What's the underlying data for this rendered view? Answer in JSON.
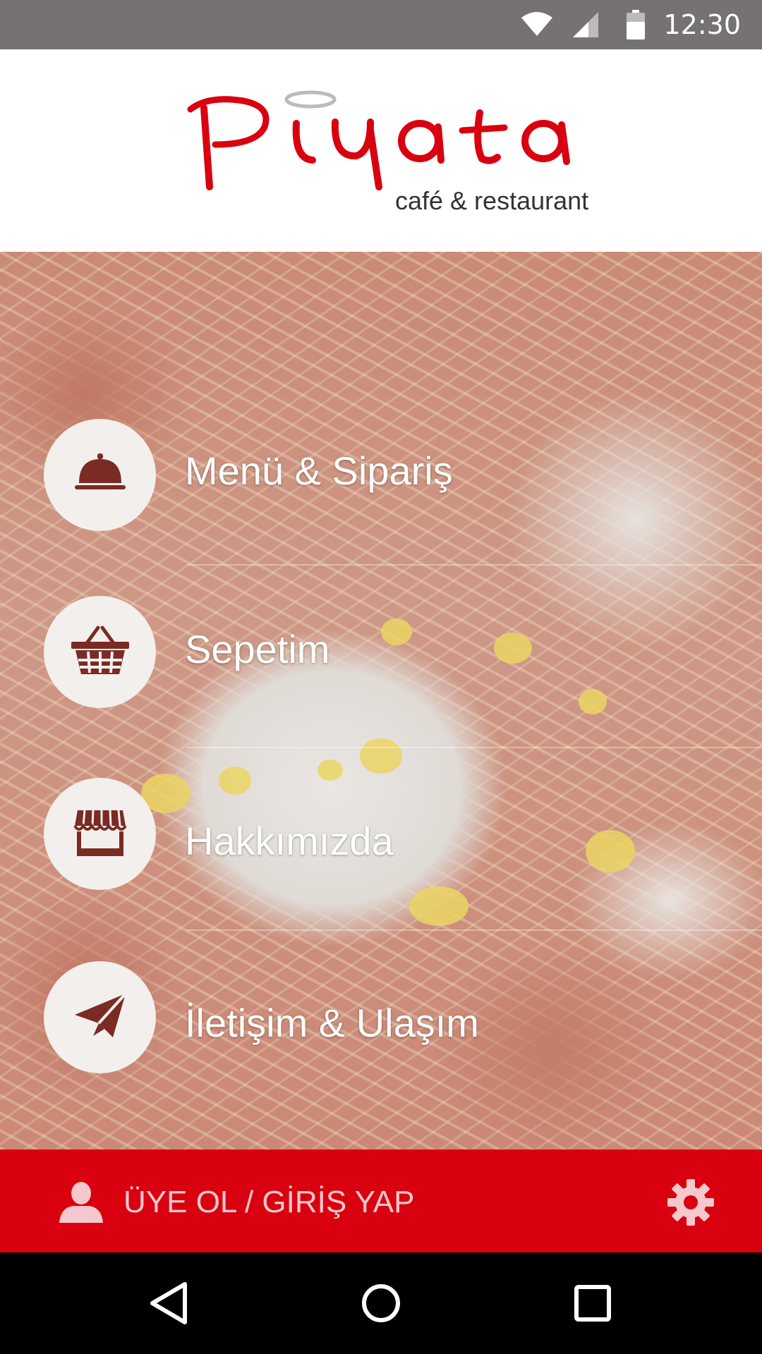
{
  "status_bar": {
    "time": "12:30",
    "icons": [
      "wifi-icon",
      "signal-icon",
      "battery-icon"
    ]
  },
  "header": {
    "logo_name": "Piyata",
    "tagline": "café & restaurant",
    "brand_color": "#d9000f"
  },
  "menu": {
    "items": [
      {
        "label": "Menü & Sipariş",
        "icon": "cloche-icon"
      },
      {
        "label": "Sepetim",
        "icon": "basket-icon"
      },
      {
        "label": "Hakkımızda",
        "icon": "storefront-icon"
      },
      {
        "label": "İletişim & Ulaşım",
        "icon": "paper-plane-icon"
      }
    ]
  },
  "bottom_bar": {
    "login_label": "ÜYE OL / GİRİŞ YAP",
    "background": "#d9000f",
    "icons": [
      "user-icon",
      "gear-icon"
    ]
  },
  "nav_bar": {
    "buttons": [
      "back-icon",
      "home-icon",
      "recents-icon"
    ]
  }
}
